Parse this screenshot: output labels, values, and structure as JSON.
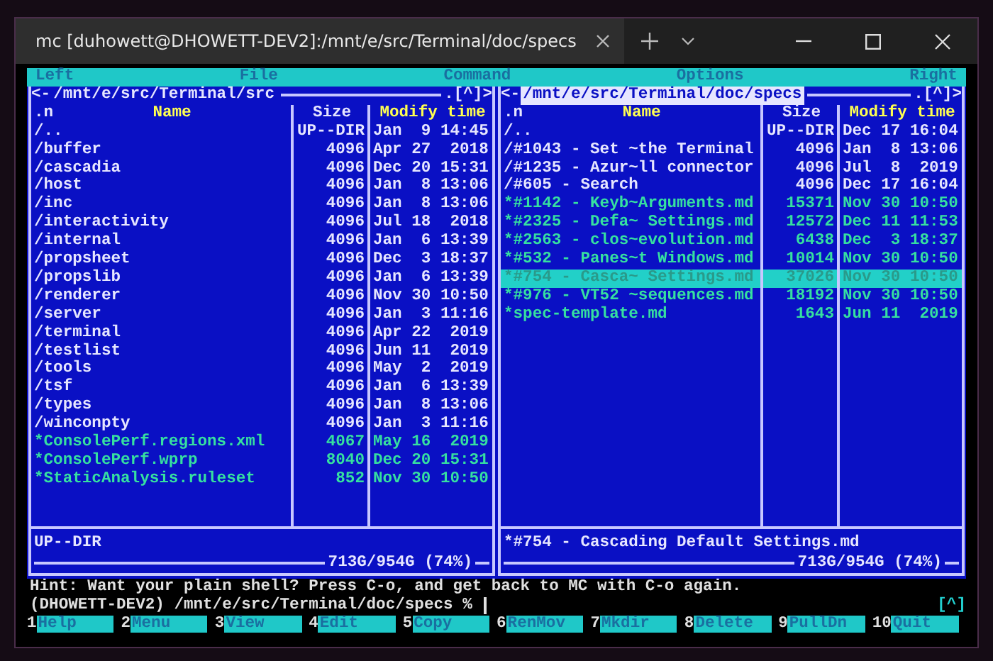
{
  "window": {
    "tab_title": "mc [duhowett@DHOWETT-DEV2]:/mnt/e/src/Terminal/doc/specs"
  },
  "menu": [
    "Left",
    "File",
    "Command",
    "Options",
    "Right"
  ],
  "panels": [
    {
      "active": false,
      "back": "<-",
      "path": "/mnt/e/src/Terminal/src",
      "corner": ".[^]>",
      "headers": [
        {
          "text": ".n",
          "sorted": false
        },
        {
          "text": "Name",
          "sorted": true
        },
        {
          "text": "Size",
          "sorted": false
        },
        {
          "text": "Modify time",
          "sorted": true
        }
      ],
      "rows": [
        {
          "kind": "dir",
          "name": "/..",
          "size": "UP--DIR",
          "time": "Jan  9 14:45",
          "selected": false
        },
        {
          "kind": "dir",
          "name": "/buffer",
          "size": "4096",
          "time": "Apr 27  2018",
          "selected": false
        },
        {
          "kind": "dir",
          "name": "/cascadia",
          "size": "4096",
          "time": "Dec 20 15:31",
          "selected": false
        },
        {
          "kind": "dir",
          "name": "/host",
          "size": "4096",
          "time": "Jan  8 13:06",
          "selected": false
        },
        {
          "kind": "dir",
          "name": "/inc",
          "size": "4096",
          "time": "Jan  8 13:06",
          "selected": false
        },
        {
          "kind": "dir",
          "name": "/interactivity",
          "size": "4096",
          "time": "Jul 18  2018",
          "selected": false
        },
        {
          "kind": "dir",
          "name": "/internal",
          "size": "4096",
          "time": "Jan  6 13:39",
          "selected": false
        },
        {
          "kind": "dir",
          "name": "/propsheet",
          "size": "4096",
          "time": "Dec  3 18:37",
          "selected": false
        },
        {
          "kind": "dir",
          "name": "/propslib",
          "size": "4096",
          "time": "Jan  6 13:39",
          "selected": false
        },
        {
          "kind": "dir",
          "name": "/renderer",
          "size": "4096",
          "time": "Nov 30 10:50",
          "selected": false
        },
        {
          "kind": "dir",
          "name": "/server",
          "size": "4096",
          "time": "Jan  3 11:16",
          "selected": false
        },
        {
          "kind": "dir",
          "name": "/terminal",
          "size": "4096",
          "time": "Apr 22  2019",
          "selected": false
        },
        {
          "kind": "dir",
          "name": "/testlist",
          "size": "4096",
          "time": "Jun 11  2019",
          "selected": false
        },
        {
          "kind": "dir",
          "name": "/tools",
          "size": "4096",
          "time": "May  2  2019",
          "selected": false
        },
        {
          "kind": "dir",
          "name": "/tsf",
          "size": "4096",
          "time": "Jan  6 13:39",
          "selected": false
        },
        {
          "kind": "dir",
          "name": "/types",
          "size": "4096",
          "time": "Jan  8 13:06",
          "selected": false
        },
        {
          "kind": "dir",
          "name": "/winconpty",
          "size": "4096",
          "time": "Jan  3 11:16",
          "selected": false
        },
        {
          "kind": "file",
          "name": "*ConsolePerf.regions.xml",
          "size": "4067",
          "time": "May 16  2019",
          "selected": false
        },
        {
          "kind": "file",
          "name": "*ConsolePerf.wprp",
          "size": "8040",
          "time": "Dec 20 15:31",
          "selected": false
        },
        {
          "kind": "file",
          "name": "*StaticAnalysis.ruleset",
          "size": "852",
          "time": "Nov 30 10:50",
          "selected": false
        }
      ],
      "mini_status": "UP--DIR",
      "disk": "713G/954G (74%)"
    },
    {
      "active": true,
      "back": "<-",
      "path": "/mnt/e/src/Terminal/doc/specs",
      "corner": ".[^]>",
      "headers": [
        {
          "text": ".n",
          "sorted": false
        },
        {
          "text": "Name",
          "sorted": true
        },
        {
          "text": "Size",
          "sorted": false
        },
        {
          "text": "Modify time",
          "sorted": true
        }
      ],
      "rows": [
        {
          "kind": "dir",
          "name": "/..",
          "size": "UP--DIR",
          "time": "Dec 17 16:04",
          "selected": false
        },
        {
          "kind": "dir",
          "name": "/#1043 - Set ~the Terminal",
          "size": "4096",
          "time": "Jan  8 13:06",
          "selected": false
        },
        {
          "kind": "dir",
          "name": "/#1235 - Azur~ll connector",
          "size": "4096",
          "time": "Jul  8  2019",
          "selected": false
        },
        {
          "kind": "dir",
          "name": "/#605 - Search",
          "size": "4096",
          "time": "Dec 17 16:04",
          "selected": false
        },
        {
          "kind": "file",
          "name": "*#1142 - Keyb~Arguments.md",
          "size": "15371",
          "time": "Nov 30 10:50",
          "selected": false
        },
        {
          "kind": "file",
          "name": "*#2325 - Defa~ Settings.md",
          "size": "12572",
          "time": "Dec 11 11:53",
          "selected": false
        },
        {
          "kind": "file",
          "name": "*#2563 - clos~evolution.md",
          "size": "6438",
          "time": "Dec  3 18:37",
          "selected": false
        },
        {
          "kind": "file",
          "name": "*#532 - Panes~t Windows.md",
          "size": "10014",
          "time": "Nov 30 10:50",
          "selected": false
        },
        {
          "kind": "file",
          "name": "*#754 - Casca~ Settings.md",
          "size": "37026",
          "time": "Nov 30 10:50",
          "selected": true
        },
        {
          "kind": "file",
          "name": "*#976 - VT52 ~sequences.md",
          "size": "18192",
          "time": "Nov 30 10:50",
          "selected": false
        },
        {
          "kind": "file",
          "name": "*spec-template.md",
          "size": "1643",
          "time": "Jun 11  2019",
          "selected": false
        }
      ],
      "mini_status": "*#754 - Cascading Default Settings.md",
      "disk": "713G/954G (74%)"
    }
  ],
  "hint": "Hint: Want your plain shell? Press C-o, and get back to MC with C-o again.",
  "prompt": "(DHOWETT-DEV2) /mnt/e/src/Terminal/doc/specs %",
  "prompt_corner": "[^]",
  "function_keys": [
    {
      "number": "1",
      "label": "Help"
    },
    {
      "number": "2",
      "label": "Menu"
    },
    {
      "number": "3",
      "label": "View"
    },
    {
      "number": "4",
      "label": "Edit"
    },
    {
      "number": "5",
      "label": "Copy"
    },
    {
      "number": "6",
      "label": "RenMov"
    },
    {
      "number": "7",
      "label": "Mkdir"
    },
    {
      "number": "8",
      "label": "Delete"
    },
    {
      "number": "9",
      "label": "PullDn"
    },
    {
      "number": "10",
      "label": "Quit"
    }
  ]
}
